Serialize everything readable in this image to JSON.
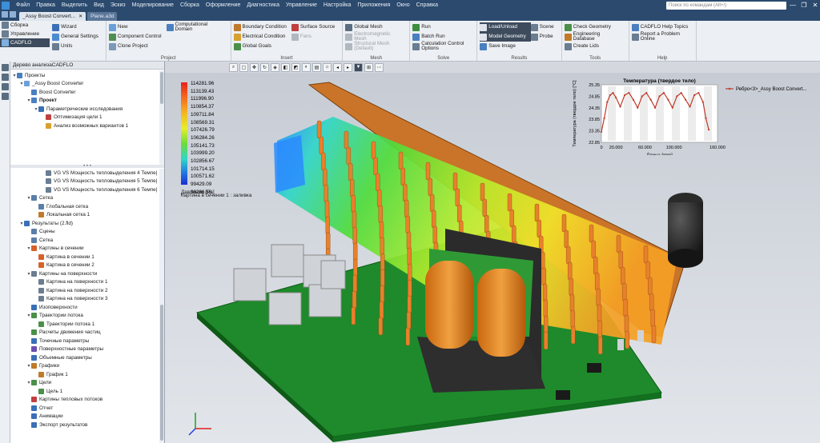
{
  "menubar": {
    "items": [
      "Файл",
      "Правка",
      "Выделить",
      "Вид",
      "Эскиз",
      "Моделирование",
      "Сборка",
      "Оформление",
      "Диагностика",
      "Управление",
      "Настройка",
      "Приложения",
      "Окно",
      "Справка"
    ],
    "search_placeholder": "Поиск по командам (Alt+/)",
    "window_buttons": [
      "—",
      "❐",
      "✕"
    ]
  },
  "tabs": [
    {
      "label": "_Assy Boost Convert...",
      "active": true
    },
    {
      "label": "Plane.a3d",
      "active": false
    }
  ],
  "sidebar_top": [
    "Сборка",
    "Управление",
    "CADFLO"
  ],
  "ribbon": {
    "groups": [
      {
        "name": "",
        "buttons": [
          {
            "label": "Wizard",
            "color": "#3b6fb6"
          },
          {
            "label": "General Settings",
            "color": "#4d8bd0"
          },
          {
            "label": "Units",
            "color": "#6a7d91"
          }
        ]
      },
      {
        "name": "Project",
        "buttons": [
          {
            "label": "New",
            "color": "#6aa0d8"
          },
          {
            "label": "Component Control",
            "color": "#4f8f4f"
          },
          {
            "label": "Clone Project",
            "color": "#7d98b8"
          },
          {
            "label": "Computational Domain",
            "color": "#4a7fc0"
          }
        ]
      },
      {
        "name": "Insert",
        "buttons": [
          {
            "label": "Boundary Condition",
            "color": "#c07a2a"
          },
          {
            "label": "Electrical Condition",
            "color": "#d8a030"
          },
          {
            "label": "Global Goals",
            "color": "#4a8f4a"
          },
          {
            "label": "Surface Source",
            "color": "#c04040"
          },
          {
            "label": "Fans",
            "color": "#b0b8c0",
            "disabled": true
          }
        ]
      },
      {
        "name": "Mesh",
        "buttons": [
          {
            "label": "Global Mesh",
            "color": "#5a6d80"
          },
          {
            "label": "Electromagnetic Mesh",
            "color": "#b0b8c0",
            "disabled": true
          },
          {
            "label": "Structural Mesh (Default)",
            "color": "#b0b8c0",
            "disabled": true
          }
        ]
      },
      {
        "name": "Solve",
        "buttons": [
          {
            "label": "Run",
            "color": "#3e8e3e"
          },
          {
            "label": "Batch Run",
            "color": "#4a7fc0"
          },
          {
            "label": "Calculation Control Options",
            "color": "#6a7d91"
          }
        ]
      },
      {
        "name": "Results",
        "buttons": [
          {
            "label": "Load/Unload",
            "color": "#e0e4ea",
            "selected": true
          },
          {
            "label": "Model Geometry",
            "color": "#e0e4ea",
            "selected": true
          },
          {
            "label": "Save Image",
            "color": "#4a7fc0"
          },
          {
            "label": "Scene",
            "color": "#6a7d91"
          },
          {
            "label": "Probe",
            "color": "#6a7d91"
          }
        ]
      },
      {
        "name": "Tools",
        "buttons": [
          {
            "label": "Check Geometry",
            "color": "#4a8f4a"
          },
          {
            "label": "Engineering Database",
            "color": "#c07a2a"
          },
          {
            "label": "Create Lids",
            "color": "#6a7d91"
          }
        ]
      },
      {
        "name": "Help",
        "buttons": [
          {
            "label": "CADFLO Help Topics",
            "color": "#4a7fc0"
          },
          {
            "label": "Report a Problem Online",
            "color": "#6a7d91"
          }
        ]
      }
    ]
  },
  "panel": {
    "title": "Дерево анализаCADFLO",
    "tree_top": [
      {
        "label": "Проекты",
        "level": 0,
        "toggle": "▾",
        "color": "#4a7fc0"
      },
      {
        "label": "_Assy Boost Converter",
        "level": 1,
        "toggle": "▾",
        "color": "#6aa0d8"
      },
      {
        "label": "Boost Converter",
        "level": 2,
        "toggle": "",
        "color": "#4a7fc0"
      },
      {
        "label": "Проект",
        "level": 2,
        "toggle": "▾",
        "color": "#4a7fc0",
        "bold": true
      },
      {
        "label": "Параметрические исследования",
        "level": 3,
        "toggle": "▾",
        "color": "#3b6fb6"
      },
      {
        "label": "Оптимизация цели 1",
        "level": 4,
        "toggle": "",
        "color": "#c04040"
      },
      {
        "label": "Анализ возможных вариантов 1",
        "level": 4,
        "toggle": "",
        "color": "#d8a030"
      }
    ],
    "tree_bottom": [
      {
        "label": "VG VS Мощность тепловыделения 4 Темпе|",
        "level": 4,
        "toggle": "",
        "color": "#6a7d91"
      },
      {
        "label": "VG VS Мощность тепловыделения 5 Темпе|",
        "level": 4,
        "toggle": "",
        "color": "#6a7d91"
      },
      {
        "label": "VG VS Мощность тепловыделения 6 Темпе|",
        "level": 4,
        "toggle": "",
        "color": "#6a7d91"
      },
      {
        "label": "Сетка",
        "level": 2,
        "toggle": "▾",
        "color": "#5a7fa8"
      },
      {
        "label": "Глобальная сетка",
        "level": 3,
        "toggle": "",
        "color": "#5a7fa8"
      },
      {
        "label": "Локальная сетка 1",
        "level": 3,
        "toggle": "",
        "color": "#c07a2a"
      },
      {
        "label": "Результаты (2.fld)",
        "level": 1,
        "toggle": "▾",
        "color": "#3b6fb6"
      },
      {
        "label": "Сцены",
        "level": 2,
        "toggle": "",
        "color": "#5a7fa8"
      },
      {
        "label": "Сетка",
        "level": 2,
        "toggle": "",
        "color": "#5a7fa8"
      },
      {
        "label": "Картины в сечении",
        "level": 2,
        "toggle": "▾",
        "color": "#d8602a"
      },
      {
        "label": "Картина в сечении 1",
        "level": 3,
        "toggle": "",
        "color": "#d8602a"
      },
      {
        "label": "Картина в сечении 2",
        "level": 3,
        "toggle": "",
        "color": "#d8602a"
      },
      {
        "label": "Картины на поверхности",
        "level": 2,
        "toggle": "▾",
        "color": "#6a7d91"
      },
      {
        "label": "Картина на поверхности 1",
        "level": 3,
        "toggle": "",
        "color": "#6a7d91"
      },
      {
        "label": "Картина на поверхности 2",
        "level": 3,
        "toggle": "",
        "color": "#6a7d91"
      },
      {
        "label": "Картина на поверхности 3",
        "level": 3,
        "toggle": "",
        "color": "#6a7d91"
      },
      {
        "label": "Изоповерхности",
        "level": 2,
        "toggle": "",
        "color": "#3b6fb6"
      },
      {
        "label": "Траектории потока",
        "level": 2,
        "toggle": "▾",
        "color": "#4a8f4a"
      },
      {
        "label": "Траектории потока 1",
        "level": 3,
        "toggle": "",
        "color": "#4a8f4a"
      },
      {
        "label": "Расчеты движения частиц",
        "level": 2,
        "toggle": "",
        "color": "#4a8f4a"
      },
      {
        "label": "Точечные параметры",
        "level": 2,
        "toggle": "",
        "color": "#3b6fb6"
      },
      {
        "label": "Поверхностные параметры",
        "level": 2,
        "toggle": "",
        "color": "#6a4fb0"
      },
      {
        "label": "Объемные параметры",
        "level": 2,
        "toggle": "",
        "color": "#3b6fb6"
      },
      {
        "label": "Графики",
        "level": 2,
        "toggle": "▾",
        "color": "#c07a2a"
      },
      {
        "label": "График 1",
        "level": 3,
        "toggle": "",
        "color": "#c07a2a"
      },
      {
        "label": "Цели",
        "level": 2,
        "toggle": "▾",
        "color": "#4a8f4a"
      },
      {
        "label": "Цель 1",
        "level": 3,
        "toggle": "",
        "color": "#4a8f4a"
      },
      {
        "label": "Картины тепловых потоков",
        "level": 2,
        "toggle": "",
        "color": "#c04040"
      },
      {
        "label": "Отчет",
        "level": 2,
        "toggle": "",
        "color": "#3b6fb6"
      },
      {
        "label": "Анимации",
        "level": 2,
        "toggle": "",
        "color": "#3b6fb6"
      },
      {
        "label": "Экспорт результатов",
        "level": 2,
        "toggle": "",
        "color": "#3b6fb6"
      }
    ]
  },
  "legend": {
    "values": [
      "114281.96",
      "113139.43",
      "111996.90",
      "110854.37",
      "109711.84",
      "108569.31",
      "107426.79",
      "106284.26",
      "105141.73",
      "103999.20",
      "102856.67",
      "101714.15",
      "100571.62",
      "99429.09",
      "98286.56"
    ],
    "unit": "Давление [Pa]",
    "caption": "Картина в сечении 1 : заливка"
  },
  "chart_data": {
    "type": "line",
    "title": "Температура (твердое тело)",
    "xlabel": "Длина [mm]",
    "ylabel": "Температура (твердое тело) [°C]",
    "xlim": [
      0,
      160000
    ],
    "ylim": [
      22.85,
      25.35
    ],
    "xticks": [
      "0",
      "20.000",
      "60.000",
      "100.000",
      "160.000"
    ],
    "yticks": [
      "25.35",
      "24.85",
      "24.35",
      "23.85",
      "23.35",
      "22.85"
    ],
    "series": [
      {
        "name": "Ребро<3>_Assy Boost Convert...",
        "color": "#c0392b",
        "x": [
          0,
          4000,
          8000,
          12000,
          16000,
          20000,
          26000,
          32000,
          38000,
          44000,
          50000,
          56000,
          62000,
          68000,
          74000,
          80000,
          86000,
          92000,
          98000,
          104000,
          110000,
          116000,
          122000,
          128000,
          134000,
          140000,
          144000,
          148000
        ],
        "y": [
          23.3,
          23.9,
          24.6,
          24.9,
          25.0,
          24.8,
          24.4,
          24.9,
          25.0,
          24.7,
          24.35,
          24.85,
          25.0,
          24.7,
          24.35,
          24.85,
          25.0,
          24.7,
          24.35,
          24.85,
          25.0,
          24.7,
          24.4,
          24.9,
          25.0,
          24.6,
          23.9,
          23.4
        ]
      }
    ]
  }
}
